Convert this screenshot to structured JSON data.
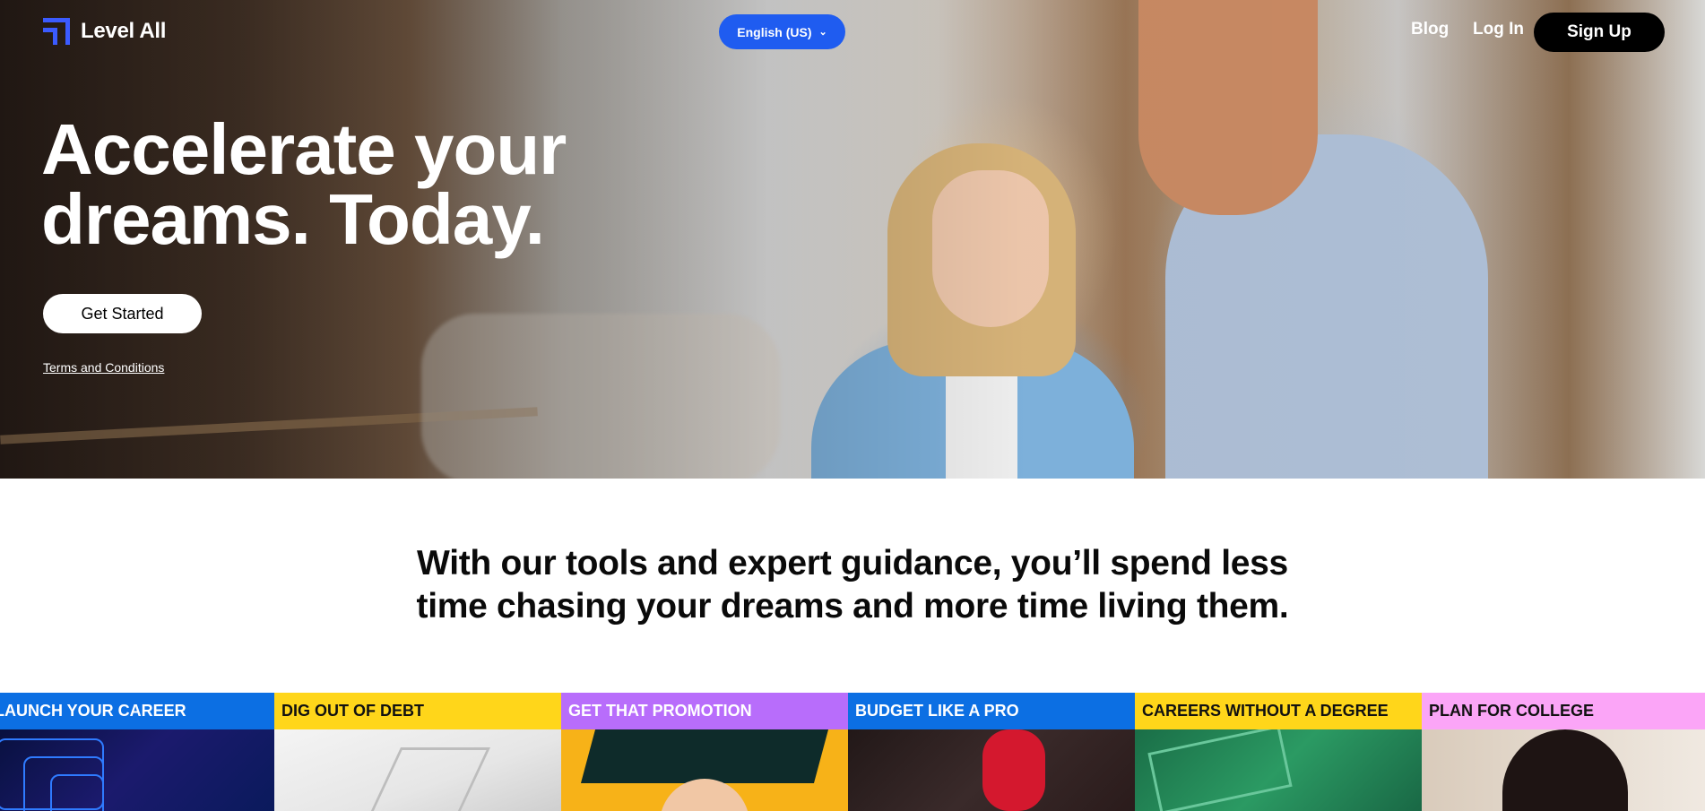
{
  "brand": {
    "name": "Level All",
    "accent": "#3b5bff"
  },
  "nav": {
    "language_label": "English (US)",
    "blog_label": "Blog",
    "login_label": "Log In",
    "signup_label": "Sign Up"
  },
  "hero": {
    "title_line1": "Accelerate your",
    "title_line2": "dreams. Today.",
    "cta_label": "Get Started",
    "terms_label": "Terms and Conditions"
  },
  "tagline": {
    "line1": "With our tools and expert guidance, you’ll spend less",
    "line2": "time chasing your dreams and more time living them."
  },
  "categories": [
    {
      "label": "LAUNCH YOUR CAREER",
      "color": "#0c6fe3"
    },
    {
      "label": "DIG OUT OF DEBT",
      "color": "#ffd61a"
    },
    {
      "label": "GET THAT PROMOTION",
      "color": "#b86dfb"
    },
    {
      "label": "BUDGET LIKE A PRO",
      "color": "#0c6fe3"
    },
    {
      "label": "CAREERS WITHOUT A DEGREE",
      "color": "#ffd61a"
    },
    {
      "label": "PLAN FOR COLLEGE",
      "color": "#fba5f7"
    }
  ],
  "icons": {
    "logo": "level-all-logo-icon",
    "language_chevron": "chevron-down-icon"
  }
}
